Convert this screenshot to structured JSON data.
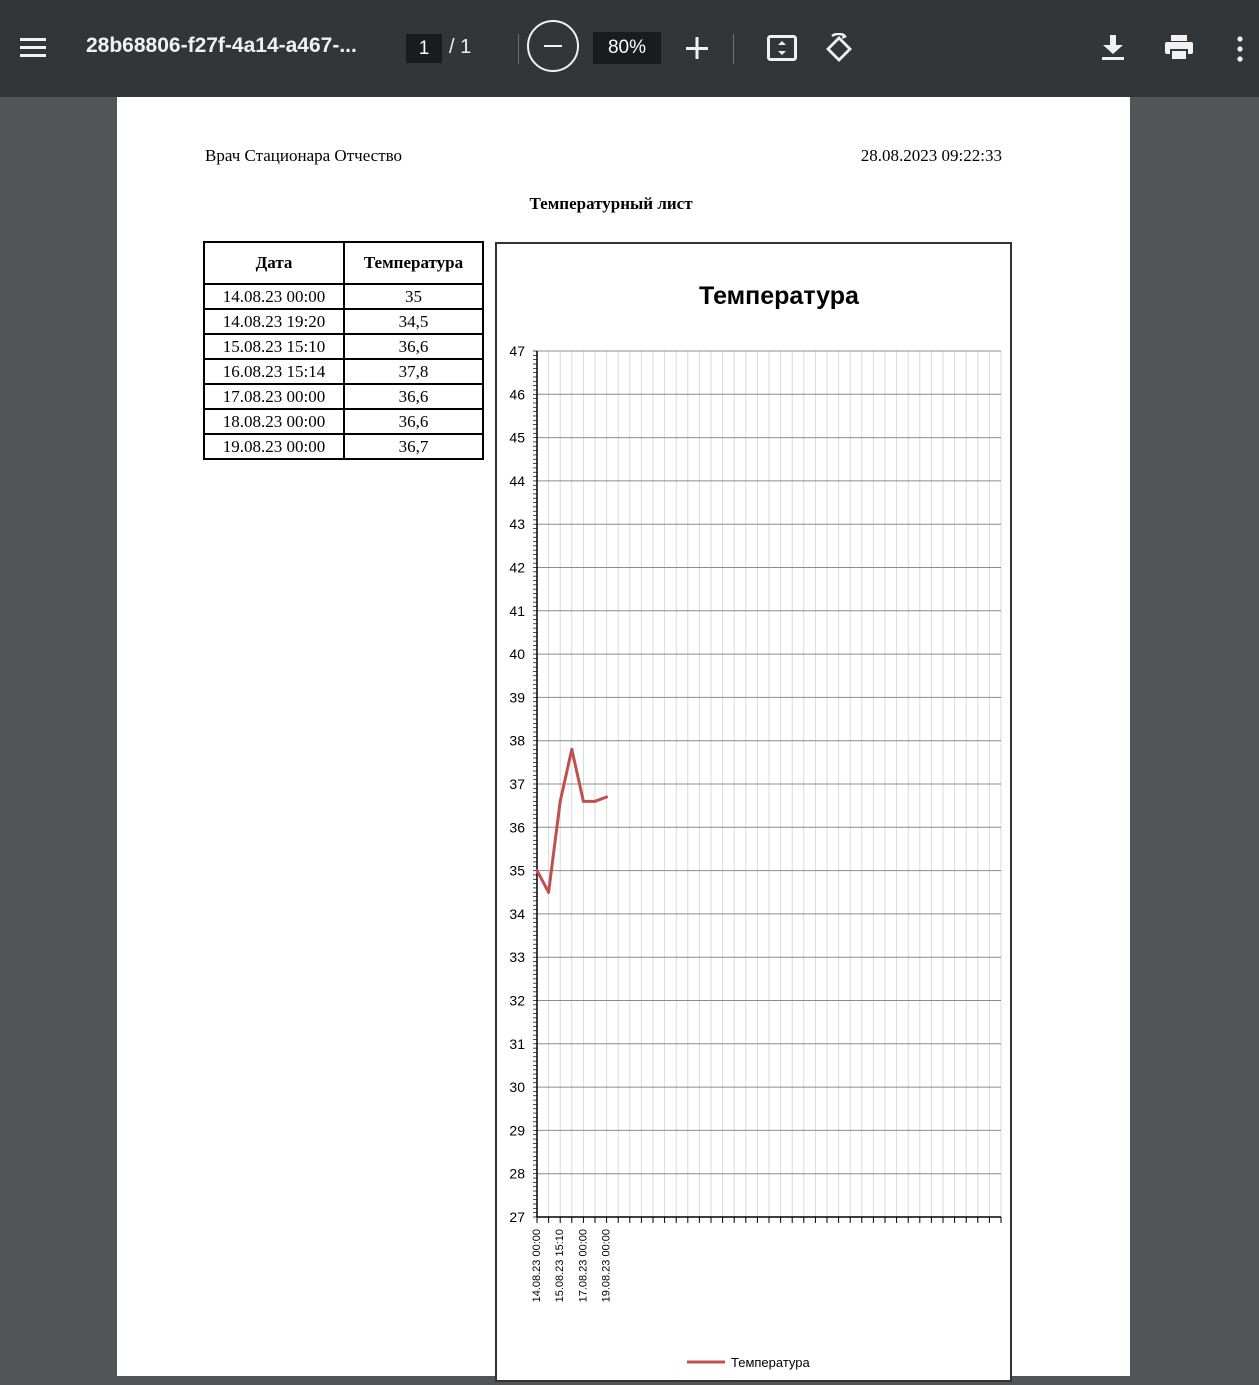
{
  "toolbar": {
    "filename": "28b68806-f27f-4a14-a467-...",
    "current_page": "1",
    "page_separator": "/",
    "total_pages": "1",
    "zoom": "80%"
  },
  "document": {
    "author": "Врач Стационара Отчество",
    "datetime": "28.08.2023 09:22:33",
    "title": "Температурный лист",
    "table": {
      "headers": [
        "Дата",
        "Температура"
      ],
      "rows": [
        [
          "14.08.23 00:00",
          "35"
        ],
        [
          "14.08.23 19:20",
          "34,5"
        ],
        [
          "15.08.23 15:10",
          "36,6"
        ],
        [
          "16.08.23 15:14",
          "37,8"
        ],
        [
          "17.08.23 00:00",
          "36,6"
        ],
        [
          "18.08.23 00:00",
          "36,6"
        ],
        [
          "19.08.23 00:00",
          "36,7"
        ]
      ]
    }
  },
  "chart_data": {
    "type": "line",
    "title": "Температура",
    "x": [
      "14.08.23 00:00",
      "14.08.23 19:20",
      "15.08.23 15:10",
      "16.08.23 15:14",
      "17.08.23 00:00",
      "18.08.23 00:00",
      "19.08.23 00:00"
    ],
    "x_tick_labels": [
      "14.08.23 00:00",
      "15.08.23 15:10",
      "17.08.23 00:00",
      "19.08.23 00:00"
    ],
    "series": [
      {
        "name": "Температура",
        "values": [
          35,
          34.5,
          36.6,
          37.8,
          36.6,
          36.6,
          36.7
        ],
        "color": "#c0504d"
      }
    ],
    "ylim": [
      27,
      47
    ],
    "y_ticks": [
      27,
      28,
      29,
      30,
      31,
      32,
      33,
      34,
      35,
      36,
      37,
      38,
      39,
      40,
      41,
      42,
      43,
      44,
      45,
      46,
      47
    ],
    "grid": true,
    "legend_position": "bottom"
  }
}
